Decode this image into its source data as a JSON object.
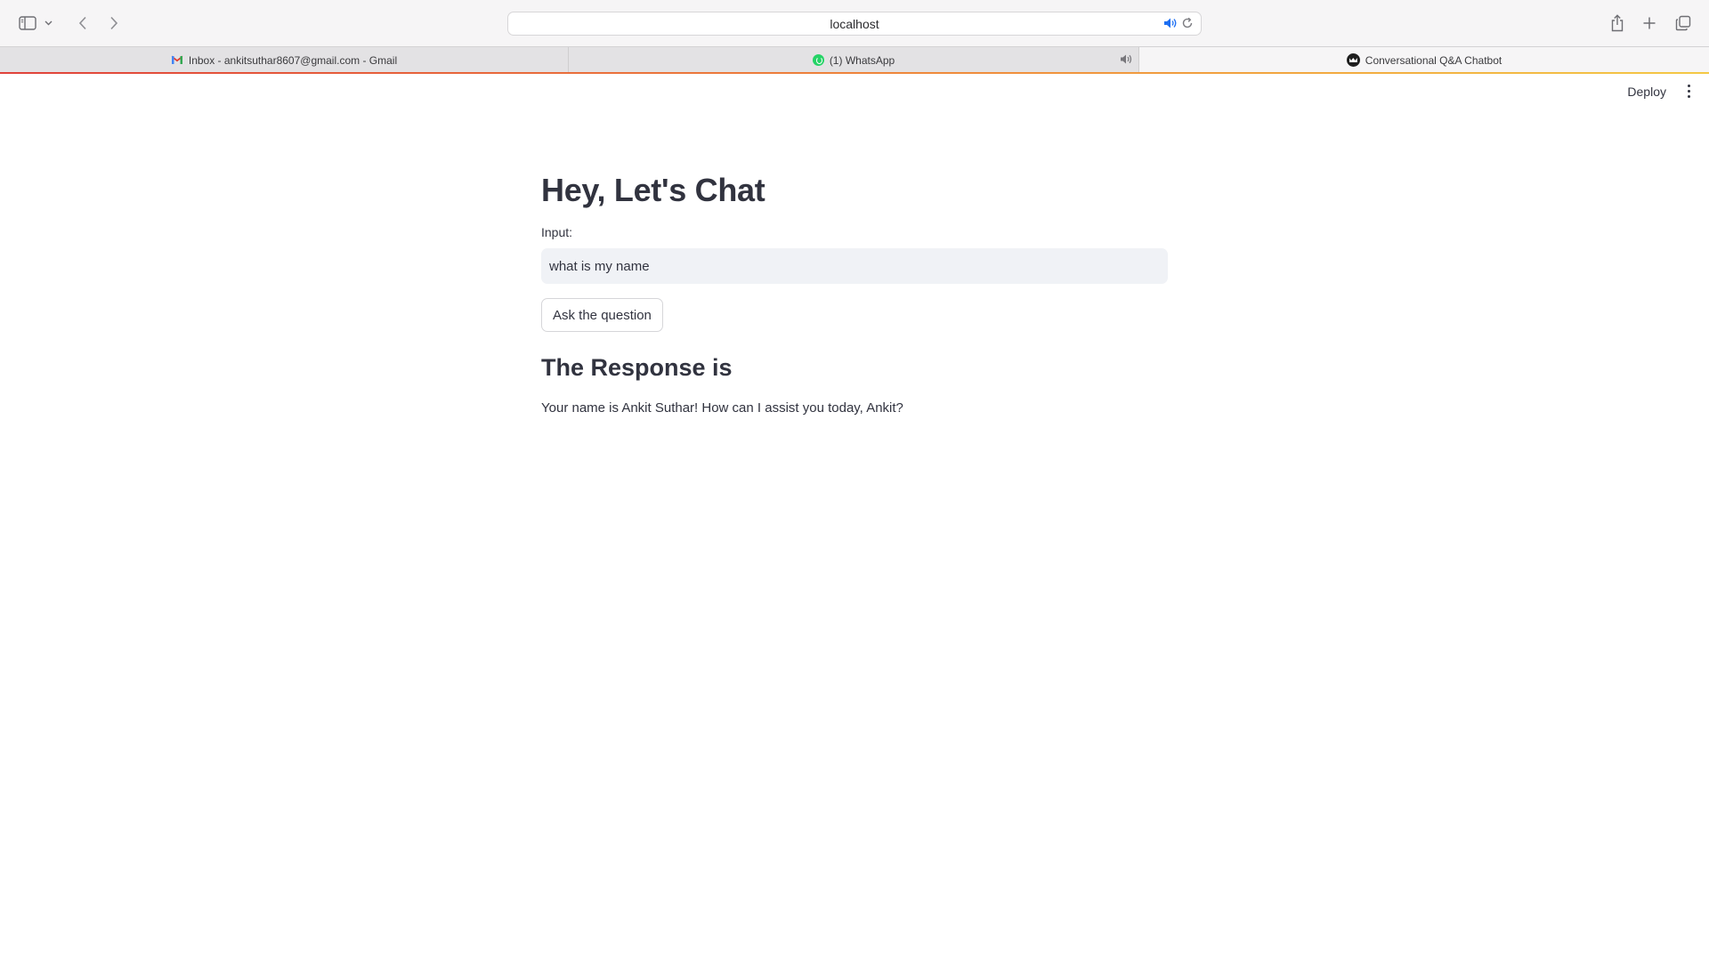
{
  "browser": {
    "url": "localhost",
    "tabs": [
      {
        "label": "Inbox - ankitsuthar8607@gmail.com - Gmail",
        "icon": "gmail-icon"
      },
      {
        "label": "(1) WhatsApp",
        "icon": "whatsapp-icon",
        "audio": true
      },
      {
        "label": "Conversational Q&A Chatbot",
        "icon": "streamlit-icon",
        "active": true
      }
    ],
    "accent_line_colors": [
      "#e0413a",
      "#f4c945"
    ]
  },
  "app": {
    "deploy_label": "Deploy",
    "title": "Hey, Let's Chat",
    "input_label": "Input:",
    "input_value": "what is my name",
    "button_label": "Ask the question",
    "response_heading": "The Response is",
    "response_text": "Your name is Ankit Suthar! How can I assist you today, Ankit?"
  }
}
